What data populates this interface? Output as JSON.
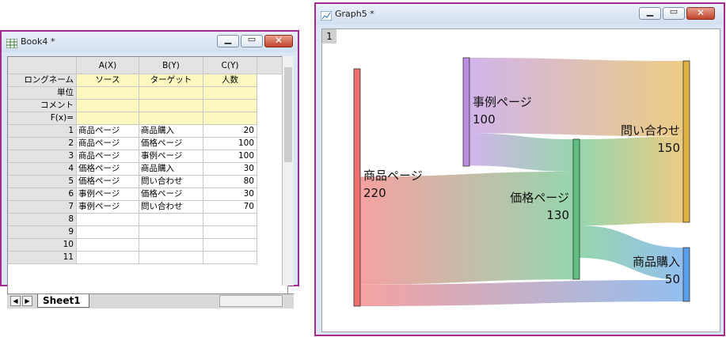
{
  "workbook": {
    "title": "Book4 *",
    "columns": [
      {
        "header": "A(X)",
        "long_name": "ソース"
      },
      {
        "header": "B(Y)",
        "long_name": "ターゲット"
      },
      {
        "header": "C(Y)",
        "long_name": "人数"
      }
    ],
    "meta_rows": [
      "ロングネーム",
      "単位",
      "コメント",
      "F(x)="
    ],
    "rows": [
      {
        "n": "1",
        "a": "商品ページ",
        "b": "商品購入",
        "c": "20"
      },
      {
        "n": "2",
        "a": "商品ページ",
        "b": "価格ページ",
        "c": "100"
      },
      {
        "n": "3",
        "a": "商品ページ",
        "b": "事例ページ",
        "c": "100"
      },
      {
        "n": "4",
        "a": "価格ページ",
        "b": "商品購入",
        "c": "30"
      },
      {
        "n": "5",
        "a": "価格ページ",
        "b": "問い合わせ",
        "c": "80"
      },
      {
        "n": "6",
        "a": "事例ページ",
        "b": "価格ページ",
        "c": "30"
      },
      {
        "n": "7",
        "a": "事例ページ",
        "b": "問い合わせ",
        "c": "70"
      },
      {
        "n": "8",
        "a": "",
        "b": "",
        "c": ""
      },
      {
        "n": "9",
        "a": "",
        "b": "",
        "c": ""
      },
      {
        "n": "10",
        "a": "",
        "b": "",
        "c": ""
      },
      {
        "n": "11",
        "a": "",
        "b": "",
        "c": ""
      }
    ],
    "sheet_tab": "Sheet1"
  },
  "graph": {
    "title": "Graph5 *",
    "layer": "1"
  },
  "sankey": {
    "nodes": [
      {
        "id": "product",
        "label": "商品ページ",
        "value": "220",
        "color": "#f07070"
      },
      {
        "id": "case",
        "label": "事例ページ",
        "value": "100",
        "color": "#b98de0"
      },
      {
        "id": "price",
        "label": "価格ページ",
        "value": "130",
        "color": "#5fbf82"
      },
      {
        "id": "inquiry",
        "label": "問い合わせ",
        "value": "150",
        "color": "#e2b042"
      },
      {
        "id": "purchase",
        "label": "商品購入",
        "value": "50",
        "color": "#5a9de8"
      }
    ],
    "links": [
      {
        "source": "product",
        "target": "purchase",
        "value": 20
      },
      {
        "source": "product",
        "target": "price",
        "value": 100
      },
      {
        "source": "product",
        "target": "case",
        "value": 100
      },
      {
        "source": "price",
        "target": "purchase",
        "value": 30
      },
      {
        "source": "price",
        "target": "inquiry",
        "value": 80
      },
      {
        "source": "case",
        "target": "price",
        "value": 30
      },
      {
        "source": "case",
        "target": "inquiry",
        "value": 70
      }
    ]
  }
}
